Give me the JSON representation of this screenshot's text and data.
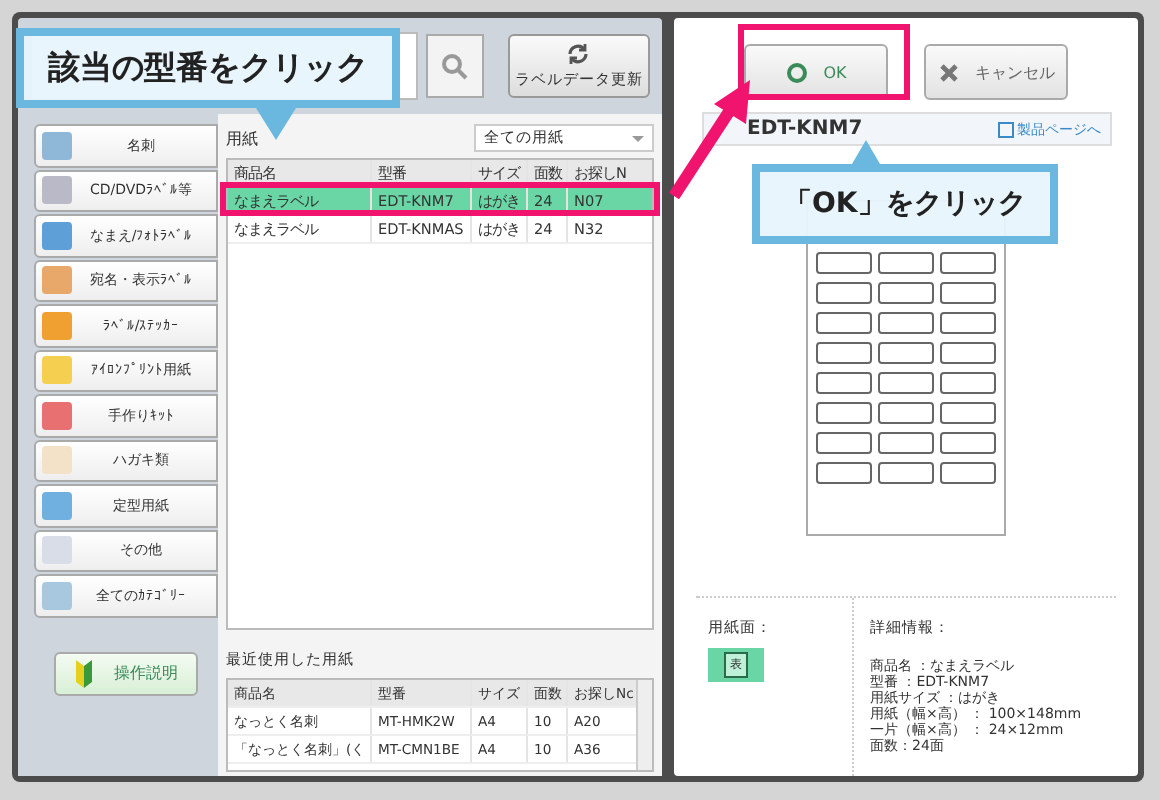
{
  "toolbar": {
    "refresh_button": "ラベルデータ更新"
  },
  "callouts": [
    {
      "text": "該当の型番をクリック"
    },
    {
      "text": "「OK」をクリック"
    }
  ],
  "categories": [
    {
      "label": "名刺",
      "color": "#8fb8d8"
    },
    {
      "label": "CD/DVDﾗﾍﾞﾙ等",
      "color": "#b9b9c8"
    },
    {
      "label": "なまえ/ﾌｫﾄﾗﾍﾞﾙ",
      "color": "#5f9fd8"
    },
    {
      "label": "宛名・表示ﾗﾍﾞﾙ",
      "color": "#e8a86a"
    },
    {
      "label": "ﾗﾍﾞﾙ/ｽﾃｯｶｰ",
      "color": "#f0a030"
    },
    {
      "label": "ｱｲﾛﾝﾌﾟﾘﾝﾄ用紙",
      "color": "#f5d050"
    },
    {
      "label": "手作りｷｯﾄ",
      "color": "#e87070"
    },
    {
      "label": "ハガキ類",
      "color": "#f3e2c8"
    },
    {
      "label": "定型用紙",
      "color": "#70b0e0"
    },
    {
      "label": "その他",
      "color": "#d8dde8"
    },
    {
      "label": "全てのｶﾃｺﾞﾘｰ",
      "color": "#a8c8e0"
    }
  ],
  "help_button": "操作説明",
  "paper": {
    "label": "用紙",
    "filter": "全ての用紙",
    "columns": [
      "商品名",
      "型番",
      "サイズ",
      "面数",
      "お探しN"
    ],
    "rows": [
      {
        "cells": [
          "なまえラベル",
          "EDT-KNM7",
          "はがき",
          "24",
          "N07"
        ],
        "selected": true
      },
      {
        "cells": [
          "なまえラベル",
          "EDT-KNMAS",
          "はがき",
          "24",
          "N32"
        ],
        "selected": false
      }
    ]
  },
  "recent": {
    "title": "最近使用した用紙",
    "columns": [
      "商品名",
      "型番",
      "サイズ",
      "面数",
      "お探しNc"
    ],
    "rows": [
      [
        "なっとく名刺",
        "MT-HMK2W",
        "A4",
        "10",
        "A20"
      ],
      [
        "「なっとく名刺」(く",
        "MT-CMN1BE",
        "A4",
        "10",
        "A36"
      ]
    ]
  },
  "buttons": {
    "ok": "OK",
    "cancel": "キャンセル"
  },
  "product": {
    "model": "EDT-KNM7",
    "link": "製品ページへ"
  },
  "side": {
    "label": "用紙面：",
    "badge": "表"
  },
  "details": {
    "title": "詳細情報：",
    "lines": [
      "商品名 ：なまえラベル",
      "型番 ：EDT-KNM7",
      "用紙サイズ ：はがき",
      "用紙（幅×高） ： 100×148mm",
      "一片（幅×高） ： 24×12mm",
      "面数：24面"
    ]
  }
}
